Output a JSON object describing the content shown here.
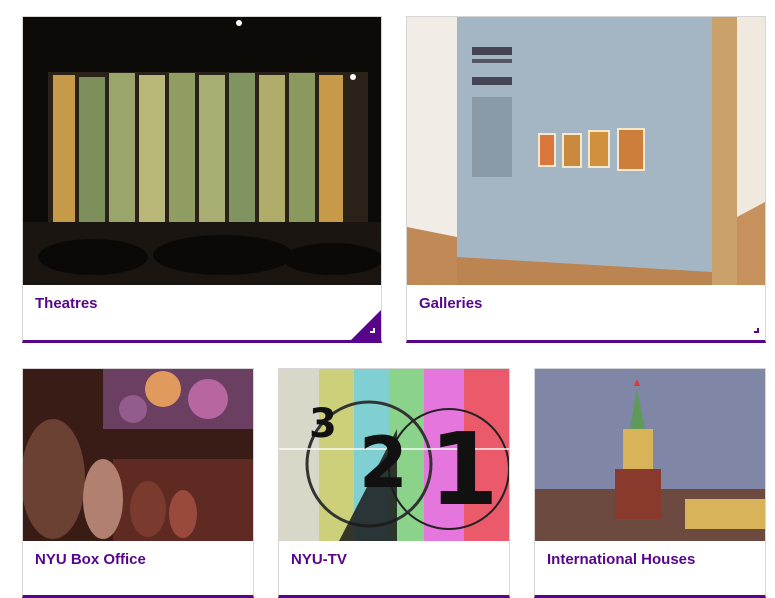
{
  "cards": [
    {
      "label": "Theatres",
      "image": "theatre-orchestra-photo"
    },
    {
      "label": "Galleries",
      "image": "gallery-exhibition-photo"
    },
    {
      "label": "NYU Box Office",
      "image": "audience-seating-photo"
    },
    {
      "label": "NYU-TV",
      "image": "film-countdown-leader-photo"
    },
    {
      "label": "International Houses",
      "image": "kremlin-tower-photo"
    }
  ],
  "colors": {
    "accent": "#57068c",
    "border": "#d6d6d6"
  }
}
